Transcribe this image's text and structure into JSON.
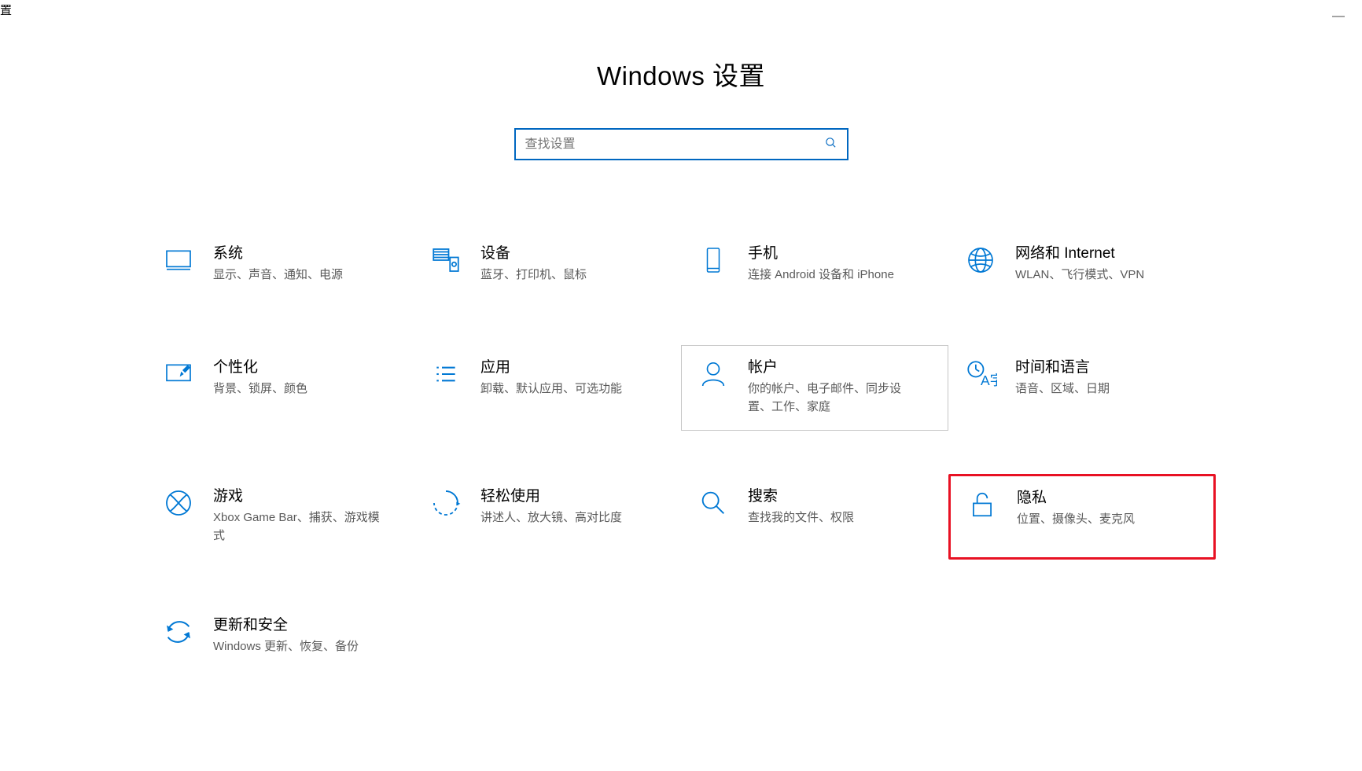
{
  "window": {
    "corner_char": "置",
    "minimize": "—"
  },
  "page_title": "Windows 设置",
  "search": {
    "placeholder": "查找设置"
  },
  "tiles": {
    "system": {
      "title": "系统",
      "desc": "显示、声音、通知、电源"
    },
    "devices": {
      "title": "设备",
      "desc": "蓝牙、打印机、鼠标"
    },
    "phone": {
      "title": "手机",
      "desc": "连接 Android 设备和 iPhone"
    },
    "network": {
      "title": "网络和 Internet",
      "desc": "WLAN、飞行模式、VPN"
    },
    "personal": {
      "title": "个性化",
      "desc": "背景、锁屏、颜色"
    },
    "apps": {
      "title": "应用",
      "desc": "卸载、默认应用、可选功能"
    },
    "accounts": {
      "title": "帐户",
      "desc": "你的帐户、电子邮件、同步设置、工作、家庭"
    },
    "time": {
      "title": "时间和语言",
      "desc": "语音、区域、日期"
    },
    "gaming": {
      "title": "游戏",
      "desc": "Xbox Game Bar、捕获、游戏模式"
    },
    "ease": {
      "title": "轻松使用",
      "desc": "讲述人、放大镜、高对比度"
    },
    "search_t": {
      "title": "搜索",
      "desc": "查找我的文件、权限"
    },
    "privacy": {
      "title": "隐私",
      "desc": "位置、摄像头、麦克风"
    },
    "update": {
      "title": "更新和安全",
      "desc": "Windows 更新、恢复、备份"
    }
  }
}
